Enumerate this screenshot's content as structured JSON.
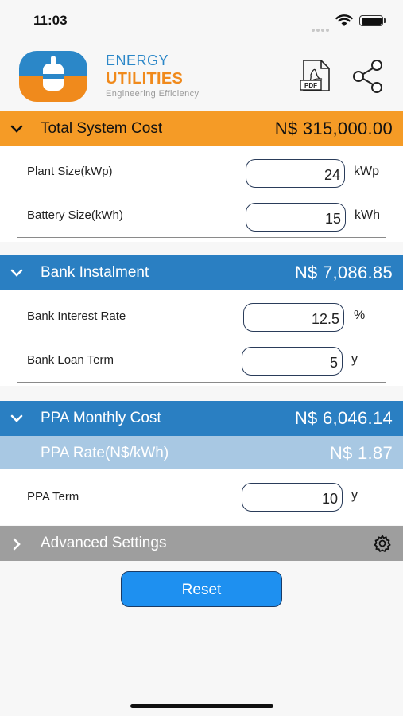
{
  "status": {
    "time": "11:03"
  },
  "brand": {
    "line1": "ENERGY",
    "line2": "UTILITIES",
    "tagline": "Engineering Efficiency",
    "pdf_label": "PDF"
  },
  "colors": {
    "orange": "#f59b26",
    "blue": "#2a7fc2",
    "light_blue": "#a8c8e3",
    "grey": "#9e9e9e",
    "button": "#1e90f0"
  },
  "total": {
    "title": "Total System Cost",
    "value": "N$ 315,000.00",
    "plant_label": "Plant Size(kWp)",
    "plant_value": "24",
    "plant_unit": "kWp",
    "battery_label": "Battery Size(kWh)",
    "battery_value": "15",
    "battery_unit": "kWh"
  },
  "bank": {
    "title": "Bank Instalment",
    "value": "N$ 7,086.85",
    "rate_label": "Bank Interest Rate",
    "rate_value": "12.5",
    "rate_unit": "%",
    "term_label": "Bank Loan Term",
    "term_value": "5",
    "term_unit": "y"
  },
  "ppa": {
    "title": "PPA Monthly Cost",
    "value": "N$ 6,046.14",
    "rate_title": "PPA Rate(N$/kWh)",
    "rate_value": "N$ 1.87",
    "term_label": "PPA Term",
    "term_value": "10",
    "term_unit": "y"
  },
  "advanced": {
    "title": "Advanced Settings"
  },
  "reset_label": "Reset"
}
